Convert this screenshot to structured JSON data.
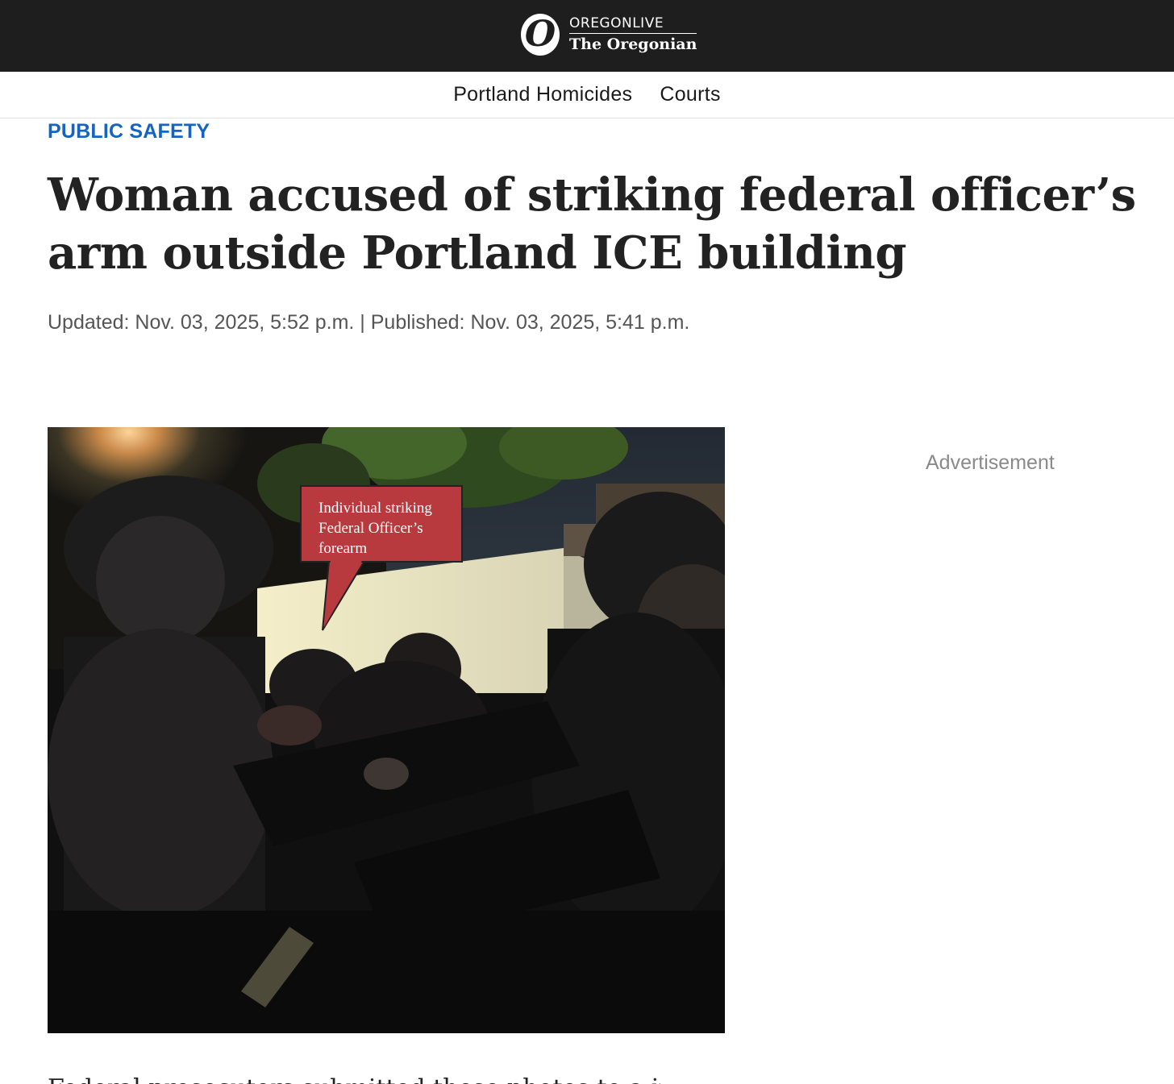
{
  "header": {
    "logo_initial": "O",
    "logo_top": "OREGONLIVE",
    "logo_bottom": "The Oregonian"
  },
  "nav": {
    "items": [
      "Portland Homicides",
      "Courts"
    ]
  },
  "article": {
    "section": "PUBLIC SAFETY",
    "headline": "Woman accused of striking federal officer’s arm outside Portland ICE building",
    "updated": "Updated: Nov. 03, 2025, 5:52 p.m.",
    "separator": "|",
    "published": "Published: Nov. 03, 2025, 5:41 p.m.",
    "photo_callout": "Individual striking Federal Officer’s forearm",
    "body_first_line": "Federal prosecutors submitted these photos to a judge in"
  },
  "sidebar": {
    "ad_label": "Advertisement"
  },
  "colors": {
    "topbar": "#1e1e1e",
    "section": "#1565c0",
    "callout": "#b93a3e"
  }
}
